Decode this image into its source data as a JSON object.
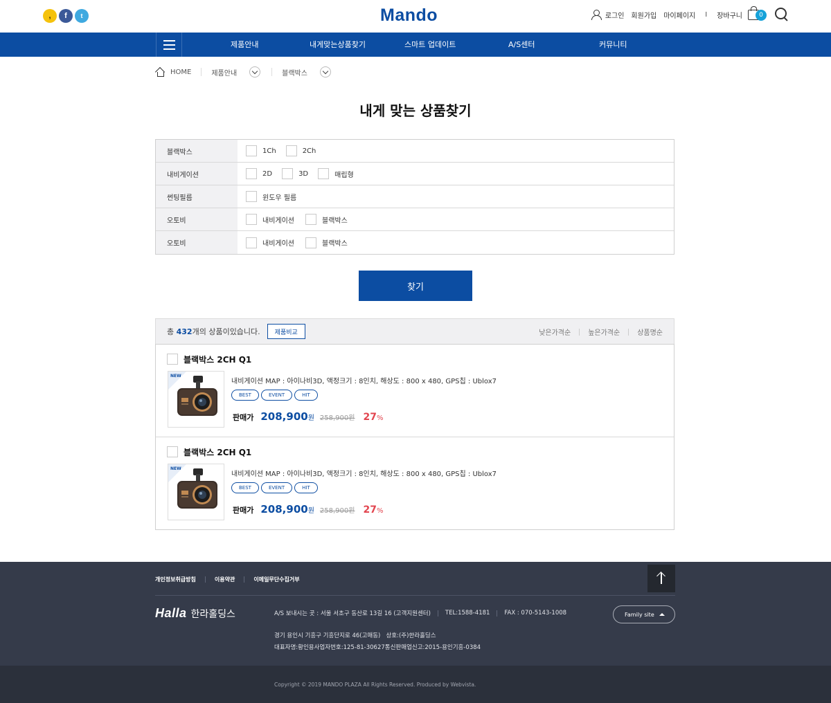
{
  "header": {
    "logo": "Mando",
    "sns": [
      "kakao-story",
      "facebook",
      "twitter"
    ],
    "util": {
      "login": "로그인",
      "join": "회원가입",
      "mypage": "마이페이지",
      "separator": "I",
      "cart": "장바구니",
      "cart_count": "0"
    }
  },
  "nav": {
    "items": [
      "제품안내",
      "내게맞는상품찾기",
      "스마트 업데이트",
      "A/S센터",
      "커뮤니티"
    ]
  },
  "breadcrumb": {
    "home": "HOME",
    "level1": "제품안내",
    "level2": "블랙박스"
  },
  "page_title": "내게 맞는 상품찾기",
  "filters": [
    {
      "label": "블랙박스",
      "options": [
        "1Ch",
        "2Ch"
      ]
    },
    {
      "label": "내비게이션",
      "options": [
        "2D",
        "3D",
        "매립형"
      ]
    },
    {
      "label": "썬팅필름",
      "options": [
        "윈도우 필름"
      ]
    },
    {
      "label": "오토비",
      "options": [
        "내비게이션",
        "블랙박스"
      ]
    },
    {
      "label": "오토비",
      "options": [
        "내비게이션",
        "블랙박스"
      ]
    }
  ],
  "find_button": "찾기",
  "results": {
    "prefix": "총 ",
    "count": "432",
    "suffix": "개의 상품이있습니다.",
    "compare_button": "제품비교",
    "sorts": [
      "낮은가격순",
      "높은가격순",
      "상품명순"
    ]
  },
  "products": [
    {
      "name": "블랙박스 2CH Q1",
      "badge": "NEW",
      "desc": "내비게이션 MAP : 아이나비3D, 액정크기 : 8인치, 해상도 : 800 x 480, GPS칩 : Ublox7",
      "tags": [
        "BEST",
        "EVENT",
        "HIT"
      ],
      "price_label": "판매가",
      "price": "208,900",
      "won": "원",
      "original": "258,900원",
      "discount": "27",
      "pct": "%"
    },
    {
      "name": "블랙박스 2CH Q1",
      "badge": "NEW",
      "desc": "내비게이션 MAP : 아이나비3D, 액정크기 : 8인치, 해상도 : 800 x 480, GPS칩 : Ublox7",
      "tags": [
        "BEST",
        "EVENT",
        "HIT"
      ],
      "price_label": "판매가",
      "price": "208,900",
      "won": "원",
      "original": "258,900원",
      "discount": "27",
      "pct": "%"
    }
  ],
  "footer": {
    "links": [
      "개인정보취급방침",
      "이용약관",
      "이메일무단수집거부"
    ],
    "brand_en": "Halla",
    "brand_ko": "한라홀딩스",
    "as_address": "A/S 보내시는 곳 : 서울 서초구 동산로 13길 16 (고객지원센터)",
    "tel": "TEL:1588-4181",
    "fax": "FAX : 070-5143-1008",
    "address": "경기 용인시 기흥구 기흥단지로 46(고매동)   상호:(주)한라홀딩스",
    "registration": "대표자명:황인용사업자번호:125-81-30627통신판매업신고:2015-용인기흥-0384",
    "family_site": "Family site",
    "copyright": "Copyright © 2019 MANDO PLAZA All Rights Reserved.  Produced by Webvista."
  },
  "colors": {
    "brand_blue": "#0c4da2",
    "discount_red": "#e2454f",
    "footer_bg": "#353b4a",
    "cart_badge": "#16a2d9"
  }
}
